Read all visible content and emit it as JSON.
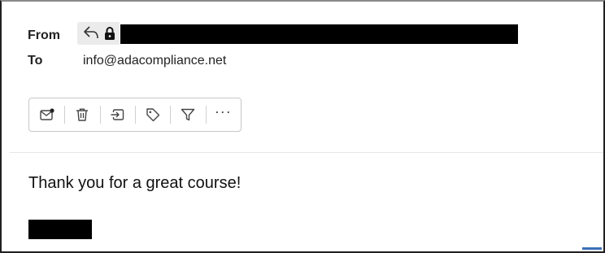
{
  "header": {
    "from_label": "From",
    "to_label": "To",
    "to_value": "info@adacompliance.net"
  },
  "toolbar": {
    "buttons": [
      {
        "name": "mark-unread",
        "icon": "envelope-dot-icon"
      },
      {
        "name": "delete",
        "icon": "trash-icon"
      },
      {
        "name": "move-to",
        "icon": "move-to-folder-icon"
      },
      {
        "name": "categorize",
        "icon": "tag-icon"
      },
      {
        "name": "filter",
        "icon": "filter-icon"
      },
      {
        "name": "more",
        "icon": "more-icon",
        "label": "···"
      }
    ]
  },
  "message": {
    "body": "Thank you for a great course!"
  },
  "colors": {
    "redaction": "#000000",
    "chip_bg": "#ebebeb",
    "toolbar_border": "#c8c8c8"
  }
}
